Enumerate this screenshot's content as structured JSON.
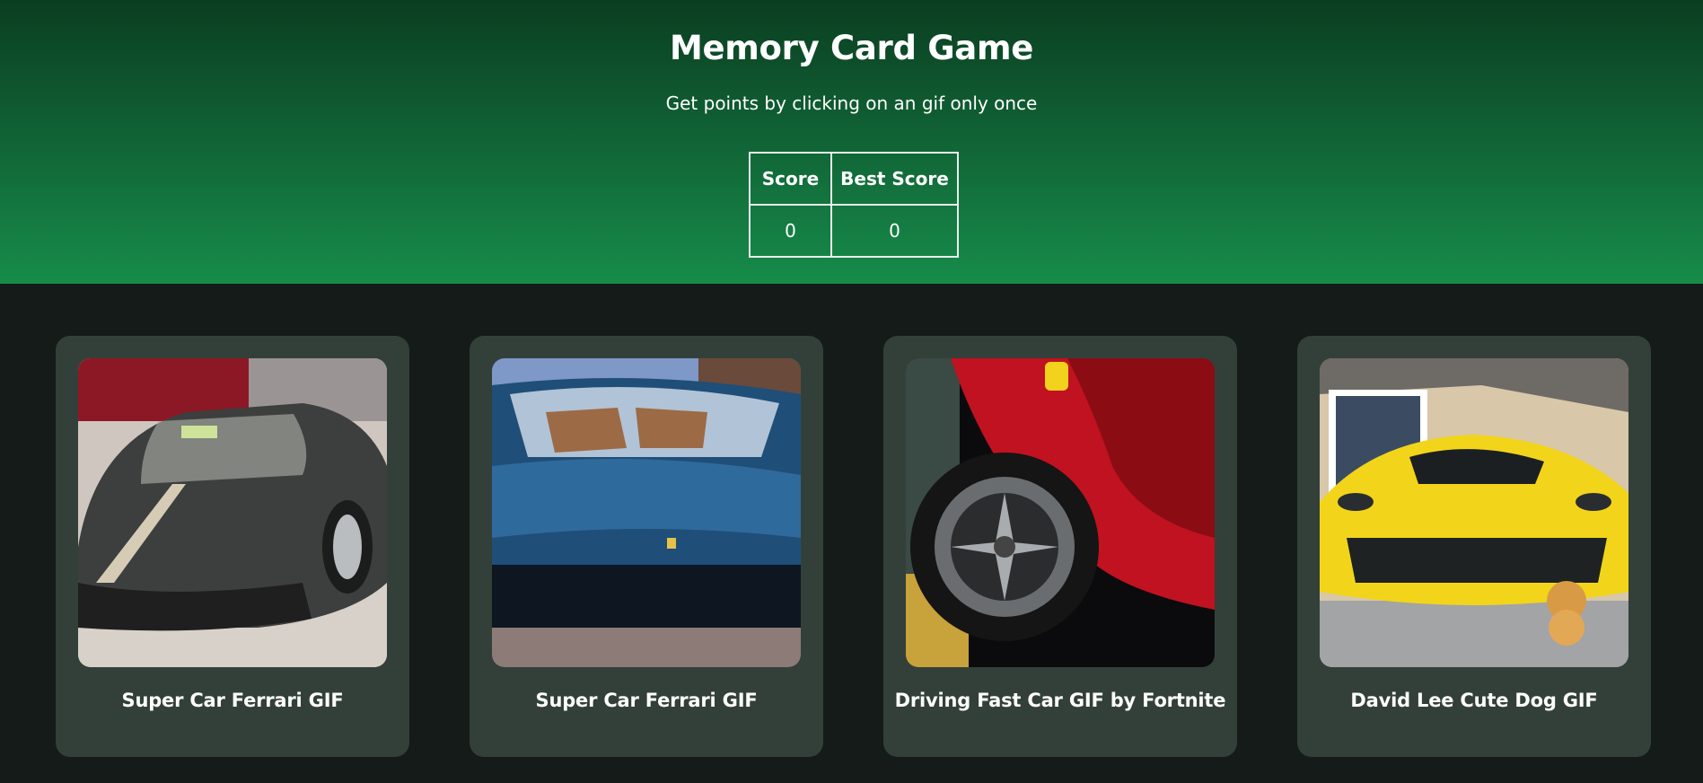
{
  "header": {
    "title": "Memory Card Game",
    "subtitle": "Get points by clicking on an gif only once"
  },
  "scoreboard": {
    "score_label": "Score",
    "best_label": "Best Score",
    "score_value": "0",
    "best_value": "0"
  },
  "cards": [
    {
      "label": "Super Car Ferrari GIF",
      "image": "grey-ferrari-showroom"
    },
    {
      "label": "Super Car Ferrari GIF",
      "image": "blue-ferrari-front"
    },
    {
      "label": "Driving Fast Car GIF by Fortnite",
      "image": "red-car-wheel"
    },
    {
      "label": "David Lee Cute Dog GIF",
      "image": "yellow-ferrari-with-dog"
    }
  ],
  "colors": {
    "header_top": "#0b3e21",
    "header_bottom": "#178c4a",
    "page_bg": "#151b18",
    "card_bg": "#334039"
  }
}
